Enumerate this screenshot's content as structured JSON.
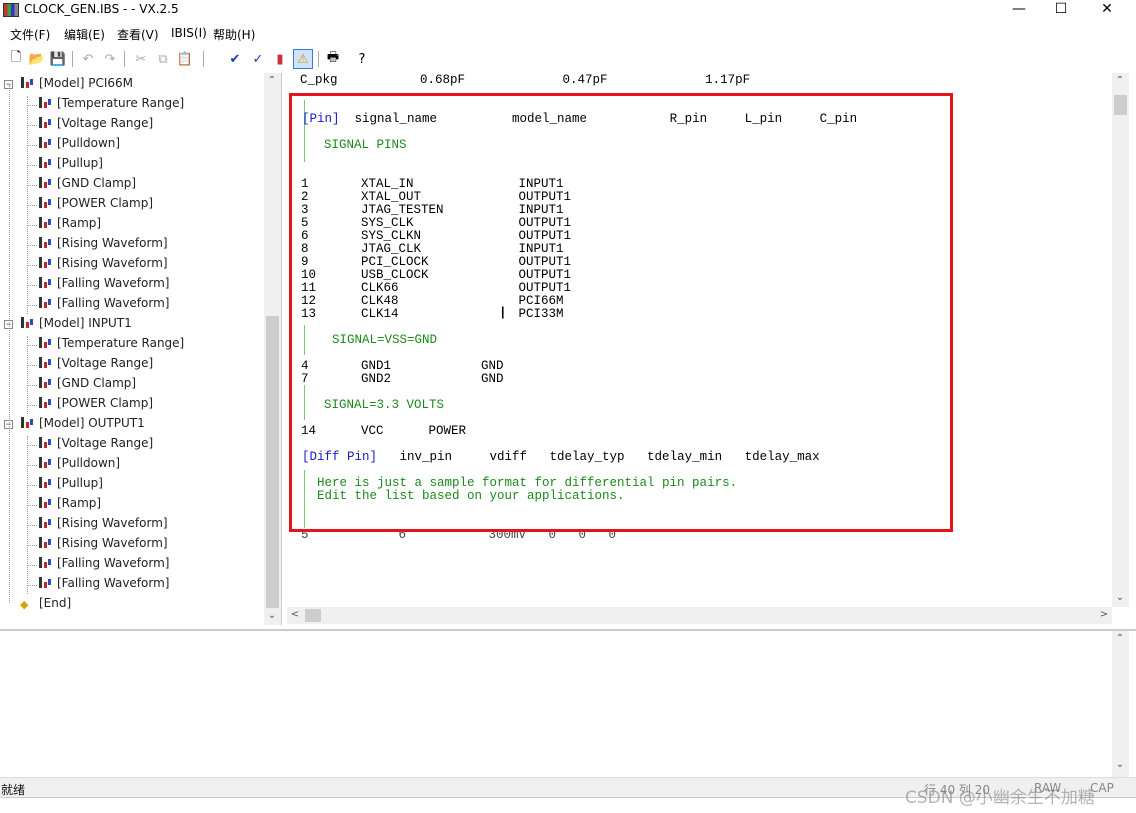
{
  "window": {
    "title": "CLOCK_GEN.IBS -  - VX.2.5",
    "minimize": "—",
    "maximize": "☐",
    "close": "✕"
  },
  "menu": [
    "文件(F)",
    "编辑(E)",
    "查看(V)",
    "IBIS(I)",
    "帮助(H)"
  ],
  "tree": {
    "items": [
      {
        "label": "[Model] PCI66M",
        "level": 0,
        "expander": "−"
      },
      {
        "label": "[Temperature Range]",
        "level": 1
      },
      {
        "label": "[Voltage Range]",
        "level": 1
      },
      {
        "label": "[Pulldown]",
        "level": 1
      },
      {
        "label": "[Pullup]",
        "level": 1
      },
      {
        "label": "[GND Clamp]",
        "level": 1
      },
      {
        "label": "[POWER Clamp]",
        "level": 1
      },
      {
        "label": "[Ramp]",
        "level": 1
      },
      {
        "label": "[Rising Waveform]",
        "level": 1
      },
      {
        "label": "[Rising Waveform]",
        "level": 1
      },
      {
        "label": "[Falling Waveform]",
        "level": 1
      },
      {
        "label": "[Falling Waveform]",
        "level": 1
      },
      {
        "label": "[Model] INPUT1",
        "level": 0,
        "expander": "−"
      },
      {
        "label": "[Temperature Range]",
        "level": 1
      },
      {
        "label": "[Voltage Range]",
        "level": 1
      },
      {
        "label": "[GND Clamp]",
        "level": 1
      },
      {
        "label": "[POWER Clamp]",
        "level": 1
      },
      {
        "label": "[Model] OUTPUT1",
        "level": 0,
        "expander": "−"
      },
      {
        "label": "[Voltage Range]",
        "level": 1
      },
      {
        "label": "[Pulldown]",
        "level": 1
      },
      {
        "label": "[Pullup]",
        "level": 1
      },
      {
        "label": "[Ramp]",
        "level": 1
      },
      {
        "label": "[Rising Waveform]",
        "level": 1
      },
      {
        "label": "[Rising Waveform]",
        "level": 1
      },
      {
        "label": "[Falling Waveform]",
        "level": 1
      },
      {
        "label": "[Falling Waveform]",
        "level": 1
      },
      {
        "label": "[End]",
        "level": 0,
        "end": true
      }
    ]
  },
  "editor": {
    "top_line": "C_pkg           0.68pF             0.47pF             1.17pF",
    "pin_header_kw": "[Pin]",
    "pin_header_rest": "  signal_name          model_name           R_pin     L_pin     C_pin",
    "signal_pins_comment": "SIGNAL PINS",
    "pin_rows": [
      "1       XTAL_IN              INPUT1",
      "2       XTAL_OUT             OUTPUT1",
      "3       JTAG_TESTEN          INPUT1",
      "5       SYS_CLK              OUTPUT1",
      "6       SYS_CLKN             OUTPUT1",
      "8       JTAG_CLK             INPUT1",
      "9       PCI_CLOCK            OUTPUT1",
      "10      USB_CLOCK            OUTPUT1",
      "11      CLK66                OUTPUT1",
      "12      CLK48                PCI66M",
      "13      CLK14                PCI33M"
    ],
    "vss_comment": "SIGNAL=VSS=GND",
    "gnd_rows": [
      "4       GND1            GND",
      "7       GND2            GND"
    ],
    "vcc_comment": "SIGNAL=3.3 VOLTS",
    "vcc_row": "14      VCC      POWER",
    "diff_header_kw": "[Diff Pin]",
    "diff_header_rest": "   inv_pin     vdiff   tdelay_typ   tdelay_min   tdelay_max",
    "diff_comment_1": "Here is just a sample format for differential pin pairs.",
    "diff_comment_2": "Edit the list based on your applications.",
    "partial_row": "5            6           300mV   0   0   0"
  },
  "status": {
    "left": "就绪",
    "line_col": "行 40   列 20",
    "num": "RAW",
    "cap": "CAP"
  },
  "watermark": "CSDN @小幽余生不加糖"
}
